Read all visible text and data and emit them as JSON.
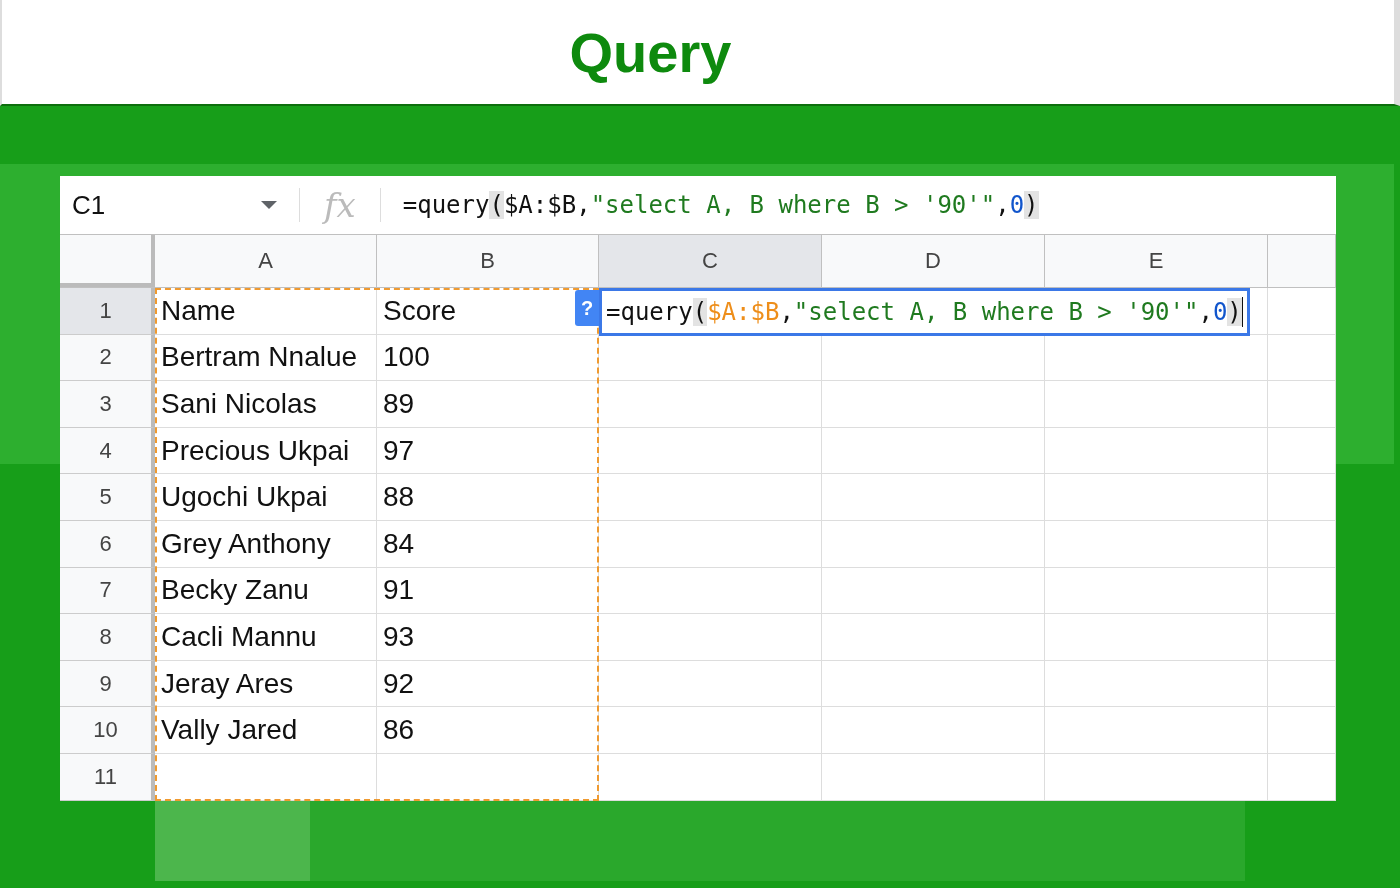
{
  "title": "Query",
  "formula_bar": {
    "cell_ref": "C1",
    "fx": "fx",
    "segments": [
      {
        "text": "=query",
        "kind": "plain"
      },
      {
        "text": "(",
        "kind": "paren"
      },
      {
        "text": "$A:$B,",
        "kind": "plain"
      },
      {
        "text": "\"select A, B where B > '90'\"",
        "kind": "string"
      },
      {
        "text": ",",
        "kind": "plain"
      },
      {
        "text": "0",
        "kind": "number"
      },
      {
        "text": ")",
        "kind": "paren"
      }
    ]
  },
  "columns": [
    {
      "label": "A",
      "selected": false,
      "referenced": true
    },
    {
      "label": "B",
      "selected": false,
      "referenced": true
    },
    {
      "label": "C",
      "selected": true,
      "referenced": false
    },
    {
      "label": "D",
      "selected": false,
      "referenced": false
    },
    {
      "label": "E",
      "selected": false,
      "referenced": false
    }
  ],
  "rows": [
    {
      "label": "1",
      "selected": true,
      "cells": [
        "Name",
        "Score"
      ]
    },
    {
      "label": "2",
      "selected": false,
      "cells": [
        "Bertram Nnalue",
        "100"
      ]
    },
    {
      "label": "3",
      "selected": false,
      "cells": [
        "Sani Nicolas",
        "89"
      ]
    },
    {
      "label": "4",
      "selected": false,
      "cells": [
        "Precious Ukpai",
        "97"
      ]
    },
    {
      "label": "5",
      "selected": false,
      "cells": [
        "Ugochi Ukpai",
        "88"
      ]
    },
    {
      "label": "6",
      "selected": false,
      "cells": [
        "Grey Anthony",
        "84"
      ]
    },
    {
      "label": "7",
      "selected": false,
      "cells": [
        "Becky Zanu",
        "91"
      ]
    },
    {
      "label": "8",
      "selected": false,
      "cells": [
        "Cacli Mannu",
        "93"
      ]
    },
    {
      "label": "9",
      "selected": false,
      "cells": [
        "Jeray Ares",
        "92"
      ]
    },
    {
      "label": "10",
      "selected": false,
      "cells": [
        "Vally Jared",
        "86"
      ]
    },
    {
      "label": "11",
      "selected": false,
      "cells": []
    }
  ],
  "cell_editor": {
    "help": "?",
    "segments": [
      {
        "text": "=query",
        "kind": "plain"
      },
      {
        "text": "(",
        "kind": "paren"
      },
      {
        "text": "$A:$B",
        "kind": "range"
      },
      {
        "text": ",",
        "kind": "plain"
      },
      {
        "text": "\"select A, B where B > '90'\"",
        "kind": "string"
      },
      {
        "text": ",",
        "kind": "plain"
      },
      {
        "text": "0",
        "kind": "number"
      },
      {
        "text": ")",
        "kind": "paren"
      }
    ]
  }
}
